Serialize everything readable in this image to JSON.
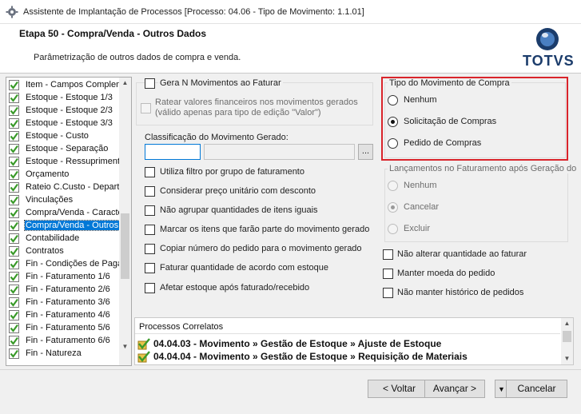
{
  "window": {
    "title": "Assistente de Implantação de Processos [Processo: 04.06 - Tipo de Movimento: 1.1.01]"
  },
  "header": {
    "step_title": "Etapa 50 - Compra/Venda - Outros Dados",
    "subtitle": "Parâmetrização de outros dados de compra e venda.",
    "logo_text": "TOTVS"
  },
  "steps": [
    {
      "label": "Item - Campos Complem",
      "checked": true
    },
    {
      "label": "Estoque - Estoque 1/3",
      "checked": true
    },
    {
      "label": "Estoque - Estoque 2/3",
      "checked": true
    },
    {
      "label": "Estoque - Estoque 3/3",
      "checked": true
    },
    {
      "label": "Estoque - Custo",
      "checked": true
    },
    {
      "label": "Estoque - Separação",
      "checked": true
    },
    {
      "label": "Estoque - Ressupriment",
      "checked": true
    },
    {
      "label": "Orçamento",
      "checked": true
    },
    {
      "label": "Rateio C.Custo - Depart",
      "checked": true
    },
    {
      "label": "Vinculações",
      "checked": true
    },
    {
      "label": "Compra/Venda - Caracte",
      "checked": true
    },
    {
      "label": "Compra/Venda - Outros",
      "checked": true,
      "selected": true
    },
    {
      "label": "Contabilidade",
      "checked": true
    },
    {
      "label": "Contratos",
      "checked": true
    },
    {
      "label": "Fin - Condições de Paga",
      "checked": true
    },
    {
      "label": "Fin - Faturamento 1/6",
      "checked": true
    },
    {
      "label": "Fin - Faturamento 2/6",
      "checked": true
    },
    {
      "label": "Fin - Faturamento 3/6",
      "checked": true
    },
    {
      "label": "Fin - Faturamento 4/6",
      "checked": true
    },
    {
      "label": "Fin - Faturamento 5/6",
      "checked": true
    },
    {
      "label": "Fin - Faturamento 6/6",
      "checked": true
    },
    {
      "label": "Fin - Natureza",
      "checked": true
    }
  ],
  "options": {
    "gerar_n_movimentos": "Gera N Movimentos ao Faturar",
    "ratear_line1": "Ratear valores financeiros nos movimentos gerados",
    "ratear_line2": "(válido apenas para tipo de edição \"Valor\")",
    "classificacao_label": "Classificação do Movimento Gerado:",
    "classificacao_value": "",
    "classificacao_desc": "",
    "lookup_button": "...",
    "utiliza_filtro": "Utiliza filtro por grupo de faturamento",
    "considerar_preco": "Considerar preço unitário com desconto",
    "nao_agrupar": "Não agrupar quantidades de itens iguais",
    "marcar_itens": "Marcar os itens que farão parte do movimento gerado",
    "copiar_numero": "Copiar número do pedido para o movimento gerado",
    "faturar_quantidade": "Faturar quantidade de acordo com estoque",
    "afetar_estoque": "Afetar estoque após faturado/recebido",
    "nao_alterar_qtd": "Não alterar quantidade ao faturar",
    "manter_moeda": "Manter moeda do pedido",
    "nao_manter_historico": "Não manter histórico de pedidos"
  },
  "tipo_movimento": {
    "legend": "Tipo do Movimento de Compra",
    "options": [
      "Nenhum",
      "Solicitação de Compras",
      "Pedido de Compras"
    ],
    "selected": "Solicitação de Compras"
  },
  "lancamentos": {
    "legend": "Lançamentos no Faturamento após Geração do",
    "options": [
      "Nenhum",
      "Cancelar",
      "Excluir"
    ],
    "selected": "Cancelar"
  },
  "processos": {
    "header": "Processos Correlatos",
    "rows": [
      "04.04.03 - Movimento » Gestão de Estoque » Ajuste de Estoque",
      "04.04.04 - Movimento » Gestão de Estoque » Requisição de Materiais"
    ]
  },
  "footer": {
    "voltar": "< Voltar",
    "avancar": "Avançar >",
    "cancelar": "Cancelar"
  },
  "colors": {
    "selection": "#0078d7",
    "highlight_border": "#d9242b",
    "logo_blue": "#1b3c6b",
    "check_green": "#3a9a2a"
  }
}
